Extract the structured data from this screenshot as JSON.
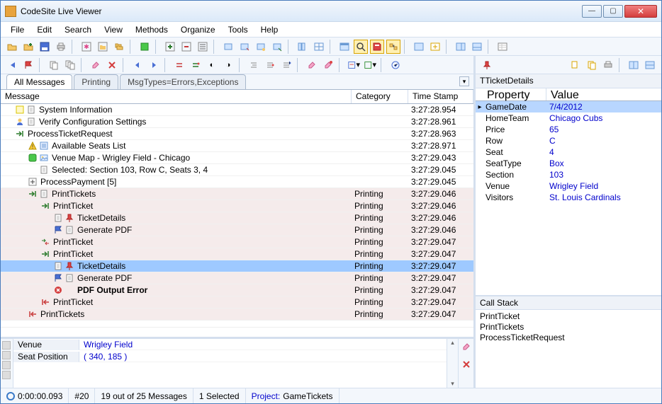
{
  "window": {
    "title": "CodeSite Live Viewer"
  },
  "menu": [
    "File",
    "Edit",
    "Search",
    "View",
    "Methods",
    "Organize",
    "Tools",
    "Help"
  ],
  "tabs": [
    {
      "label": "All Messages",
      "active": true
    },
    {
      "label": "Printing",
      "active": false
    },
    {
      "label": "MsgTypes=Errors,Exceptions",
      "active": false
    }
  ],
  "columns": {
    "message": "Message",
    "category": "Category",
    "timestamp": "Time Stamp"
  },
  "rows": [
    {
      "indent": 0,
      "icons": [
        "note",
        "doc"
      ],
      "text": "System Information",
      "cat": "",
      "ts": "3:27:28.954",
      "alt": false
    },
    {
      "indent": 0,
      "icons": [
        "user",
        "doc"
      ],
      "text": "Verify Configuration Settings",
      "cat": "",
      "ts": "3:27:28.961",
      "alt": false
    },
    {
      "indent": 0,
      "icons": [
        "enter"
      ],
      "text": "ProcessTicketRequest",
      "cat": "",
      "ts": "3:27:28.963",
      "alt": false
    },
    {
      "indent": 1,
      "icons": [
        "warn",
        "list"
      ],
      "text": "Available Seats List",
      "cat": "",
      "ts": "3:27:28.971",
      "alt": false
    },
    {
      "indent": 1,
      "icons": [
        "green",
        "img"
      ],
      "text": "Venue Map - Wrigley Field - Chicago",
      "cat": "",
      "ts": "3:27:29.043",
      "alt": false
    },
    {
      "indent": 1,
      "icons": [
        "blank",
        "doc"
      ],
      "text": "Selected: Section 103, Row C, Seats 3, 4",
      "cat": "",
      "ts": "3:27:29.045",
      "alt": false
    },
    {
      "indent": 1,
      "icons": [
        "plus"
      ],
      "text": "ProcessPayment  [5]",
      "cat": "",
      "ts": "3:27:29.045",
      "alt": false
    },
    {
      "indent": 1,
      "icons": [
        "enter",
        "doc"
      ],
      "text": "PrintTickets",
      "cat": "Printing",
      "ts": "3:27:29.046",
      "alt": true
    },
    {
      "indent": 2,
      "icons": [
        "enter"
      ],
      "text": "PrintTicket",
      "cat": "Printing",
      "ts": "3:27:29.046",
      "alt": true
    },
    {
      "indent": 3,
      "icons": [
        "doc",
        "pin"
      ],
      "text": "TicketDetails",
      "cat": "Printing",
      "ts": "3:27:29.046",
      "alt": true
    },
    {
      "indent": 3,
      "icons": [
        "flag",
        "doc"
      ],
      "text": "Generate PDF",
      "cat": "Printing",
      "ts": "3:27:29.046",
      "alt": true
    },
    {
      "indent": 2,
      "icons": [
        "both"
      ],
      "text": "PrintTicket",
      "cat": "Printing",
      "ts": "3:27:29.047",
      "alt": true
    },
    {
      "indent": 2,
      "icons": [
        "enter"
      ],
      "text": "PrintTicket",
      "cat": "Printing",
      "ts": "3:27:29.047",
      "alt": true
    },
    {
      "indent": 3,
      "icons": [
        "doc",
        "pin"
      ],
      "text": "TicketDetails",
      "cat": "Printing",
      "ts": "3:27:29.047",
      "alt": true,
      "sel": true
    },
    {
      "indent": 3,
      "icons": [
        "flag",
        "doc"
      ],
      "text": "Generate PDF",
      "cat": "Printing",
      "ts": "3:27:29.047",
      "alt": true
    },
    {
      "indent": 3,
      "icons": [
        "err",
        "blank"
      ],
      "text": "PDF Output Error",
      "cat": "Printing",
      "ts": "3:27:29.047",
      "alt": true,
      "bold": true
    },
    {
      "indent": 2,
      "icons": [
        "exit"
      ],
      "text": "PrintTicket",
      "cat": "Printing",
      "ts": "3:27:29.047",
      "alt": true
    },
    {
      "indent": 1,
      "icons": [
        "exit"
      ],
      "text": "PrintTickets",
      "cat": "Printing",
      "ts": "3:27:29.047",
      "alt": true
    }
  ],
  "detail": [
    {
      "k": "Venue",
      "v": "Wrigley Field"
    },
    {
      "k": "Seat Position",
      "v": "( 340, 185 )"
    }
  ],
  "status": {
    "time": "0:00:00.093",
    "count": "#20",
    "filter": "19 out of 25 Messages",
    "selected": "1 Selected",
    "project_label": "Project:",
    "project": "GameTickets"
  },
  "details_title": "TTicketDetails",
  "prop_header": {
    "p": "Property",
    "v": "Value"
  },
  "props": [
    {
      "p": "GameDate",
      "v": "7/4/2012",
      "sel": true
    },
    {
      "p": "HomeTeam",
      "v": "Chicago Cubs"
    },
    {
      "p": "Price",
      "v": "65"
    },
    {
      "p": "Row",
      "v": "C"
    },
    {
      "p": "Seat",
      "v": "4"
    },
    {
      "p": "SeatType",
      "v": "Box"
    },
    {
      "p": "Section",
      "v": "103"
    },
    {
      "p": "Venue",
      "v": "Wrigley Field"
    },
    {
      "p": "Visitors",
      "v": "St. Louis Cardinals"
    }
  ],
  "callstack_title": "Call Stack",
  "callstack": [
    "PrintTicket",
    "PrintTickets",
    "ProcessTicketRequest"
  ]
}
